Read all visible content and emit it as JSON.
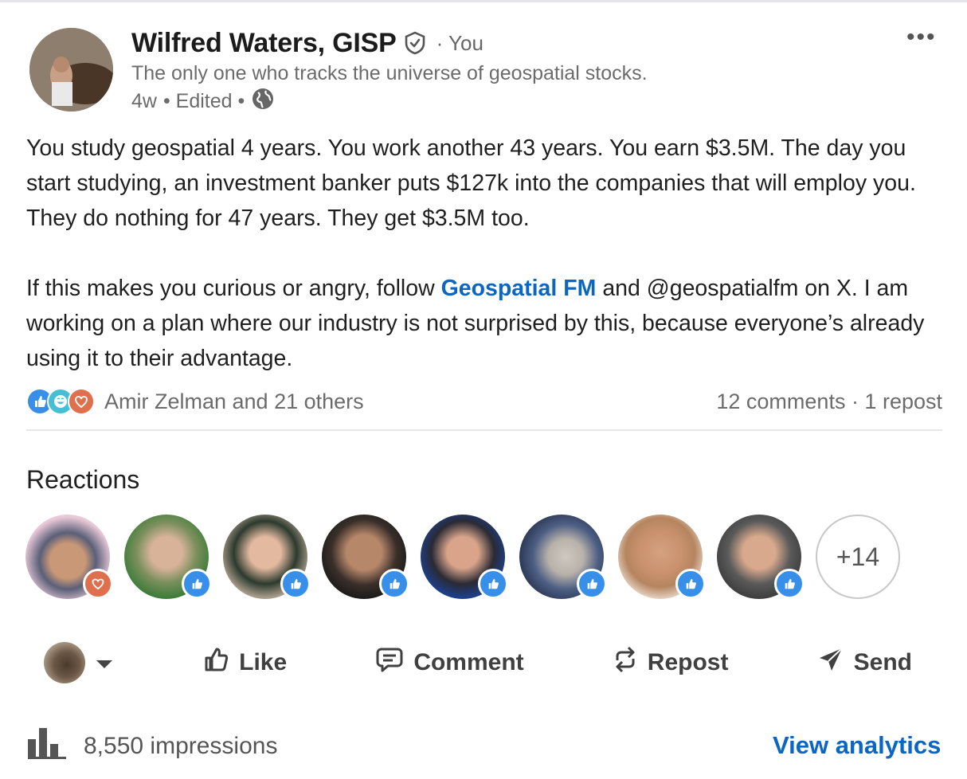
{
  "post": {
    "author_name": "Wilfred Waters, GISP",
    "author_badge": "verified-icon",
    "you_label": "· You",
    "headline": "The only one who tracks the universe of geospatial stocks.",
    "age": "4w",
    "edited": "• Edited •",
    "visibility_icon": "globe-icon",
    "body_p1": "You study geospatial 4 years. You work another 43 years. You earn $3.5M. The day you start studying, an investment banker puts $127k into the companies that will employ you. They do nothing for 47 years. They get $3.5M too.",
    "body_p2_before": "If this makes you curious or angry, follow ",
    "body_p2_link": "Geospatial FM",
    "body_p2_after": " and @geospatialfm on X. I am working on a plan where our industry is not surprised by this, because everyone’s already using it to their advantage."
  },
  "social": {
    "reactors": "Amir Zelman and 21 others",
    "counts": "12 comments · 1 repost",
    "reaction_icons": [
      "like-icon",
      "funny-icon",
      "love-icon"
    ]
  },
  "reactions_section": {
    "title": "Reactions",
    "more_count": "+14"
  },
  "actions": {
    "like": "Like",
    "comment": "Comment",
    "repost": "Repost",
    "send": "Send"
  },
  "footer": {
    "impressions": "8,550 impressions",
    "view_analytics": "View analytics"
  },
  "colors": {
    "link": "#0a66c2",
    "like_badge": "#378fe9",
    "love_badge": "#df704d",
    "funny_badge": "#44bfd3"
  }
}
